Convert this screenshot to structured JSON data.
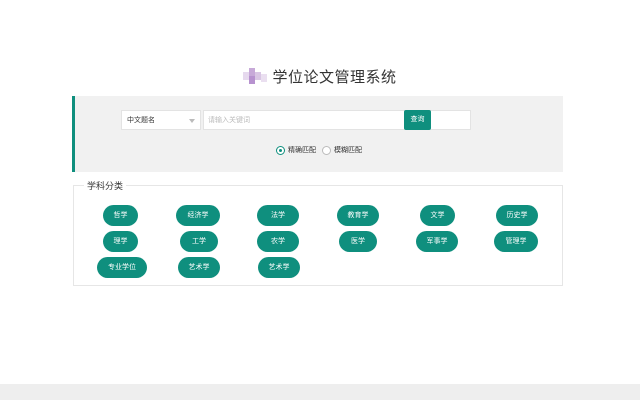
{
  "header": {
    "title": "学位论文管理系统",
    "logo_icon": "blurred-logo-icon"
  },
  "search": {
    "field_select": {
      "selected": "中文题名"
    },
    "keyword_input": {
      "value": "",
      "placeholder": "请输入关键词"
    },
    "query_button_label": "查询",
    "match_options": [
      {
        "label": "精确匹配",
        "checked": true
      },
      {
        "label": "模糊匹配",
        "checked": false
      }
    ]
  },
  "categories": {
    "legend": "学科分类",
    "items": [
      "哲学",
      "经济学",
      "法学",
      "教育学",
      "文学",
      "历史学",
      "理学",
      "工学",
      "农学",
      "医学",
      "军事学",
      "管理学",
      "专业学位",
      "艺术学",
      "艺术学"
    ]
  },
  "colors": {
    "accent": "#0f8f7e",
    "panel_bg": "#f1f1f1"
  }
}
